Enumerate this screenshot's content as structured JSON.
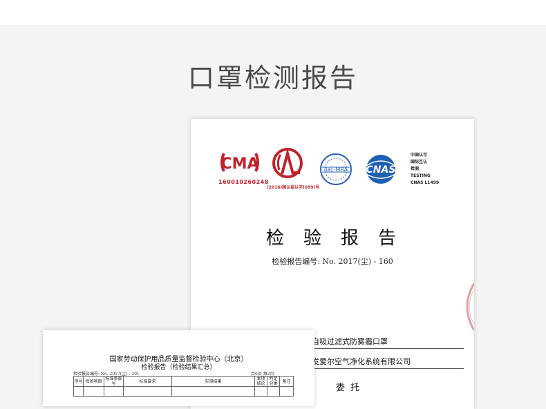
{
  "page": {
    "title": "口罩检测报告"
  },
  "main_report": {
    "logos": {
      "cma": {
        "letters": "CMA",
        "number": "160010260248",
        "color": "#c0222b"
      },
      "cal": {
        "letters": "CAL",
        "caption": "(2016)国认监认字(099)号",
        "color": "#c0222b"
      },
      "ilac": {
        "text": "ilac-MRA",
        "color": "#2a62b8"
      },
      "cnas": {
        "text": "CNAS",
        "color": "#1f5fb3"
      },
      "cnas_side": [
        "中国认可",
        "国际互认",
        "检测",
        "TESTING",
        "CNAS L1499"
      ]
    },
    "heading": "检验报告",
    "report_number": "检验报告编号: No. 2017(尘) - 160",
    "product_name": "自吸过滤式防雾霾口罩",
    "company_name": "发爱尔空气净化系统有限公司",
    "inspection_type": "委托",
    "stamp_color": "#e0a0a0"
  },
  "summary_report": {
    "title": "国家劳动保护用品质量监督检验中心（北京）",
    "subtitle": "检验报告（检验结果汇总）",
    "report_number": "检验报告编号: No. 2017(尘) - 201",
    "pages": "共6页  第2页",
    "table_headers": [
      "序号",
      "检验项目",
      "标准条款号",
      "标准要求",
      "实测结果",
      "本项结论",
      "判定分类",
      "备注"
    ]
  }
}
